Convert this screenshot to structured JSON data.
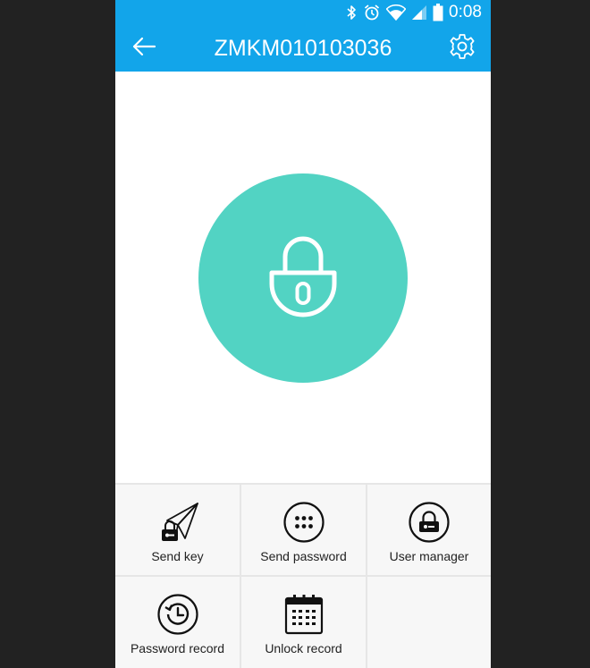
{
  "status_bar": {
    "time": "0:08",
    "icons": [
      "bluetooth-icon",
      "alarm-icon",
      "wifi-icon",
      "signal-icon",
      "battery-icon"
    ]
  },
  "app_bar": {
    "title": "ZMKM010103036",
    "back_icon": "arrow-left-icon",
    "settings_icon": "gear-icon"
  },
  "lock": {
    "icon": "padlock-icon",
    "color": "#52d3c3"
  },
  "colors": {
    "primary": "#12a5ea",
    "accent": "#52d3c3",
    "background": "#222222"
  },
  "actions": [
    {
      "label": "Send key",
      "icon": "paper-plane-key-icon"
    },
    {
      "label": "Send password",
      "icon": "keypad-icon"
    },
    {
      "label": "User manager",
      "icon": "user-lock-icon"
    },
    {
      "label": "Password record",
      "icon": "history-clock-icon"
    },
    {
      "label": "Unlock record",
      "icon": "calendar-icon"
    }
  ]
}
